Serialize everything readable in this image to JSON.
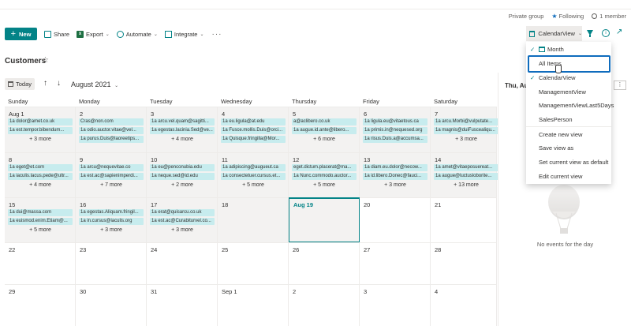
{
  "site_meta": {
    "privacy": "Private group",
    "following": "Following",
    "members": "1 member"
  },
  "commandbar": {
    "new": "New",
    "share": "Share",
    "export": "Export",
    "automate": "Automate",
    "integrate": "Integrate",
    "overflow": "···"
  },
  "view_switcher": {
    "current": "CalendarView"
  },
  "list": {
    "title": "Customers"
  },
  "calendar": {
    "today_label": "Today",
    "month": "August 2021",
    "weekdays": [
      "Sunday",
      "Monday",
      "Tuesday",
      "Wednesday",
      "Thursday",
      "Friday",
      "Saturday"
    ],
    "weeks": [
      [
        {
          "day": "Aug 1",
          "events": [
            "1a dolor@amet.co.uk",
            "1a est.tempor.bibendum..."
          ],
          "more": "+ 3 more"
        },
        {
          "day": "2",
          "events": [
            "Cras@non.com",
            "1a odio.auctor.vitae@vel...",
            "1a purus.Duis@laoreetips..."
          ],
          "more": ""
        },
        {
          "day": "3",
          "events": [
            "1a arcu.vel.quam@sagitti...",
            "1a egestas.lacinia.Sed@ve..."
          ],
          "more": "+ 4 more"
        },
        {
          "day": "4",
          "events": [
            "1a eu.ligula@at.edu",
            "1a Fusce.mollis.Duis@orci...",
            "1a Quisque.fringilla@Mor..."
          ],
          "more": ""
        },
        {
          "day": "5",
          "events": [
            "a@aclibero.co.uk",
            "1a augue.id.ante@libero..."
          ],
          "more": "+ 6 more"
        },
        {
          "day": "6",
          "events": [
            "1a ligula.eu@vitaetous.ca",
            "1a primis.in@nequesed.org",
            "1a risus.Duis.a@accumsa..."
          ],
          "more": ""
        },
        {
          "day": "7",
          "events": [
            "1a arcu.Morbi@vulputate...",
            "1a magnis@duiFuscealiqu..."
          ],
          "more": "+ 3 more"
        }
      ],
      [
        {
          "day": "8",
          "events": [
            "1a eget@et.com",
            "1a iaculis.lacus.pede@ultr..."
          ],
          "more": "+ 4 more"
        },
        {
          "day": "9",
          "events": [
            "1a arcu@nequevitae.co",
            "1a est.ac@sapienimperdi..."
          ],
          "more": "+ 7 more"
        },
        {
          "day": "10",
          "events": [
            "1a eu@penconubia.edu",
            "1a neque.sed@id.edu"
          ],
          "more": "+ 2 more"
        },
        {
          "day": "11",
          "events": [
            "1a adipiscing@augueut.ca",
            "1a consectetuer.cursus.et..."
          ],
          "more": "+ 5 more"
        },
        {
          "day": "12",
          "events": [
            "eget.dictum.placerat@ma...",
            "1a Nunc.commodo.auctor..."
          ],
          "more": "+ 5 more"
        },
        {
          "day": "13",
          "events": [
            "1a diam.eu.dolor@necow...",
            "1a id.libero.Donec@fauci..."
          ],
          "more": "+ 3 more"
        },
        {
          "day": "14",
          "events": [
            "1a amet@vitaeposuereat...",
            "1a augue@luctusloborite..."
          ],
          "more": "+ 13 more"
        }
      ],
      [
        {
          "day": "15",
          "events": [
            "1a dui@massa.com",
            "1a euismod.enim.Etiam@..."
          ],
          "more": "+ 5 more"
        },
        {
          "day": "16",
          "events": [
            "1a egestas.Aliquam.fringil...",
            "1a in.cursus@iaculis.org"
          ],
          "more": "+ 3 more"
        },
        {
          "day": "17",
          "events": [
            "1a erat@quisarcu.co.uk",
            "1a est.ac@Curabiturvel.co..."
          ],
          "more": "+ 3 more"
        },
        {
          "day": "18",
          "events": [],
          "more": ""
        },
        {
          "day": "Aug 19",
          "events": [],
          "more": "",
          "today": true
        },
        {
          "day": "20",
          "events": [],
          "more": ""
        },
        {
          "day": "21",
          "events": [],
          "more": ""
        }
      ],
      [
        {
          "day": "22",
          "events": [],
          "more": ""
        },
        {
          "day": "23",
          "events": [],
          "more": ""
        },
        {
          "day": "24",
          "events": [],
          "more": ""
        },
        {
          "day": "25",
          "events": [],
          "more": ""
        },
        {
          "day": "26",
          "events": [],
          "more": ""
        },
        {
          "day": "27",
          "events": [],
          "more": ""
        },
        {
          "day": "28",
          "events": [],
          "more": ""
        }
      ],
      [
        {
          "day": "29",
          "events": [],
          "more": ""
        },
        {
          "day": "30",
          "events": [],
          "more": ""
        },
        {
          "day": "31",
          "events": [],
          "more": ""
        },
        {
          "day": "Sep 1",
          "events": [],
          "more": ""
        },
        {
          "day": "2",
          "events": [],
          "more": ""
        },
        {
          "day": "3",
          "events": [],
          "more": ""
        },
        {
          "day": "4",
          "events": [],
          "more": ""
        }
      ]
    ]
  },
  "side_pane": {
    "heading": "Thu, Aug",
    "empty_message": "No events for the day"
  },
  "view_menu": {
    "items": [
      {
        "label": "Month",
        "checked": true,
        "calendar_icon": true
      },
      {
        "label": "All Items",
        "highlighted": true
      },
      {
        "label": "CalendarView",
        "checked": true
      },
      {
        "label": "ManagementView"
      },
      {
        "label": "ManagementViewLast5Days"
      },
      {
        "label": "SalesPerson"
      },
      {
        "label": "Create new view"
      },
      {
        "label": "Save view as"
      },
      {
        "label": "Set current view as default"
      },
      {
        "label": "Edit current view"
      }
    ]
  },
  "colors": {
    "accent": "#038387",
    "event_bg": "#c7ecee",
    "highlight_border": "#0f6cbd"
  }
}
